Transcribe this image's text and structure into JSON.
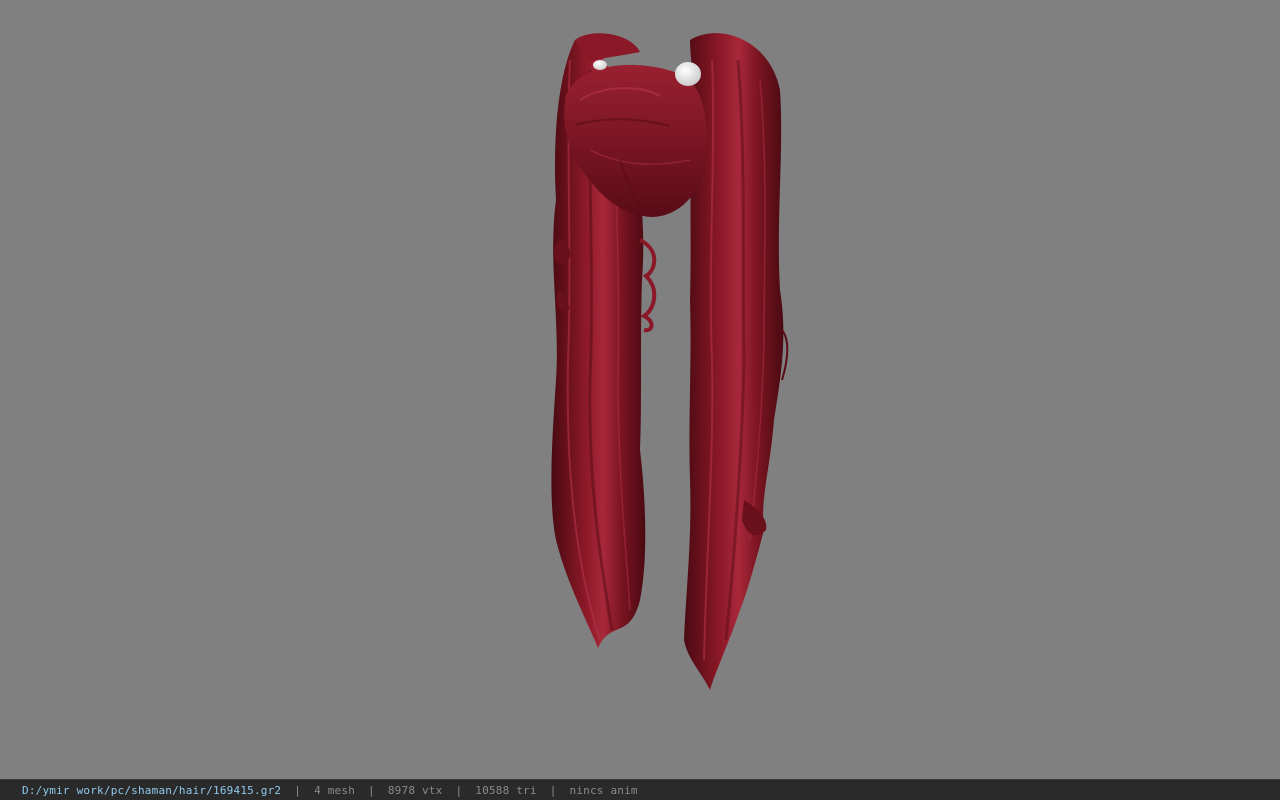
{
  "viewport": {
    "background_color": "#808080",
    "model": {
      "subject": "red twin-ponytail hair mesh",
      "hair_color": "#7a1420",
      "highlight_color": "#a8283a",
      "shadow_color": "#4a0a12",
      "hair_tie_color": "#f2f2f2"
    }
  },
  "status_bar": {
    "file_path": "D:/ymir work/pc/shaman/hair/169415.gr2",
    "separator": "|",
    "mesh_count": "4 mesh",
    "vertex_count": "8978 vtx",
    "triangle_count": "10588 tri",
    "animation": "nincs anim",
    "path_color": "#8fc8ea",
    "text_color": "#8a8a8a",
    "background_color": "#2a2a2a"
  }
}
